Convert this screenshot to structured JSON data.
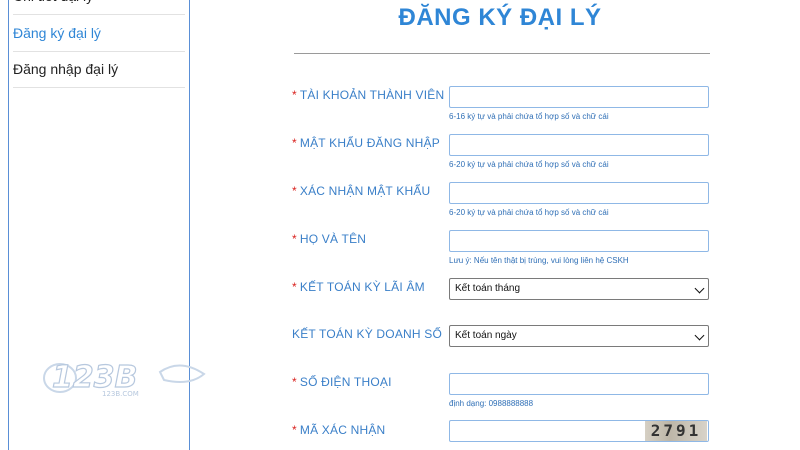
{
  "sidebar": {
    "items": [
      {
        "label": "Chi tiết đại lý"
      },
      {
        "label": "Đăng ký đại lý"
      },
      {
        "label": "Đăng nhập đại lý"
      }
    ],
    "logo_text": "123B",
    "logo_subtext": "123B.COM"
  },
  "form": {
    "title": "ĐĂNG KÝ ĐẠI LÝ",
    "fields": [
      {
        "label": "TÀI KHOẢN THÀNH VIÊN",
        "required": "*",
        "value": "",
        "hint": "6-16 ký tự và phải chứa tổ hợp số và chữ cái"
      },
      {
        "label": "MẬT KHẨU ĐĂNG NHẬP",
        "required": "*",
        "value": "",
        "hint": "6-20 ký tự và phải chứa tổ hợp số và chữ cái"
      },
      {
        "label": "XÁC NHẬN MẬT KHẨU",
        "required": "*",
        "value": "",
        "hint": "6-20 ký tự và phải chứa tổ hợp số và chữ cái"
      },
      {
        "label": "HỌ VÀ TÊN",
        "required": "*",
        "value": "",
        "hint": "Lưu ý: Nếu tên thật bị trùng, vui lòng liên hệ CSKH"
      },
      {
        "label": "KẾT TOÁN KỲ LÃI ÂM",
        "required": "*",
        "selected": "Kết toán tháng"
      },
      {
        "label": "KẾT TOÁN KỲ DOANH SỐ",
        "required": "",
        "selected": "Kết toán ngày"
      },
      {
        "label": "SỐ ĐIỆN THOẠI",
        "required": "*",
        "value": "",
        "hint": "định dạng: 0988888888"
      },
      {
        "label": "MÃ XÁC NHẬN",
        "required": "*",
        "value": "",
        "captcha": "2791"
      }
    ]
  },
  "colors": {
    "accent": "#2f86d6",
    "required": "#d9221f",
    "sidebar_border": "#5a8fd6"
  }
}
